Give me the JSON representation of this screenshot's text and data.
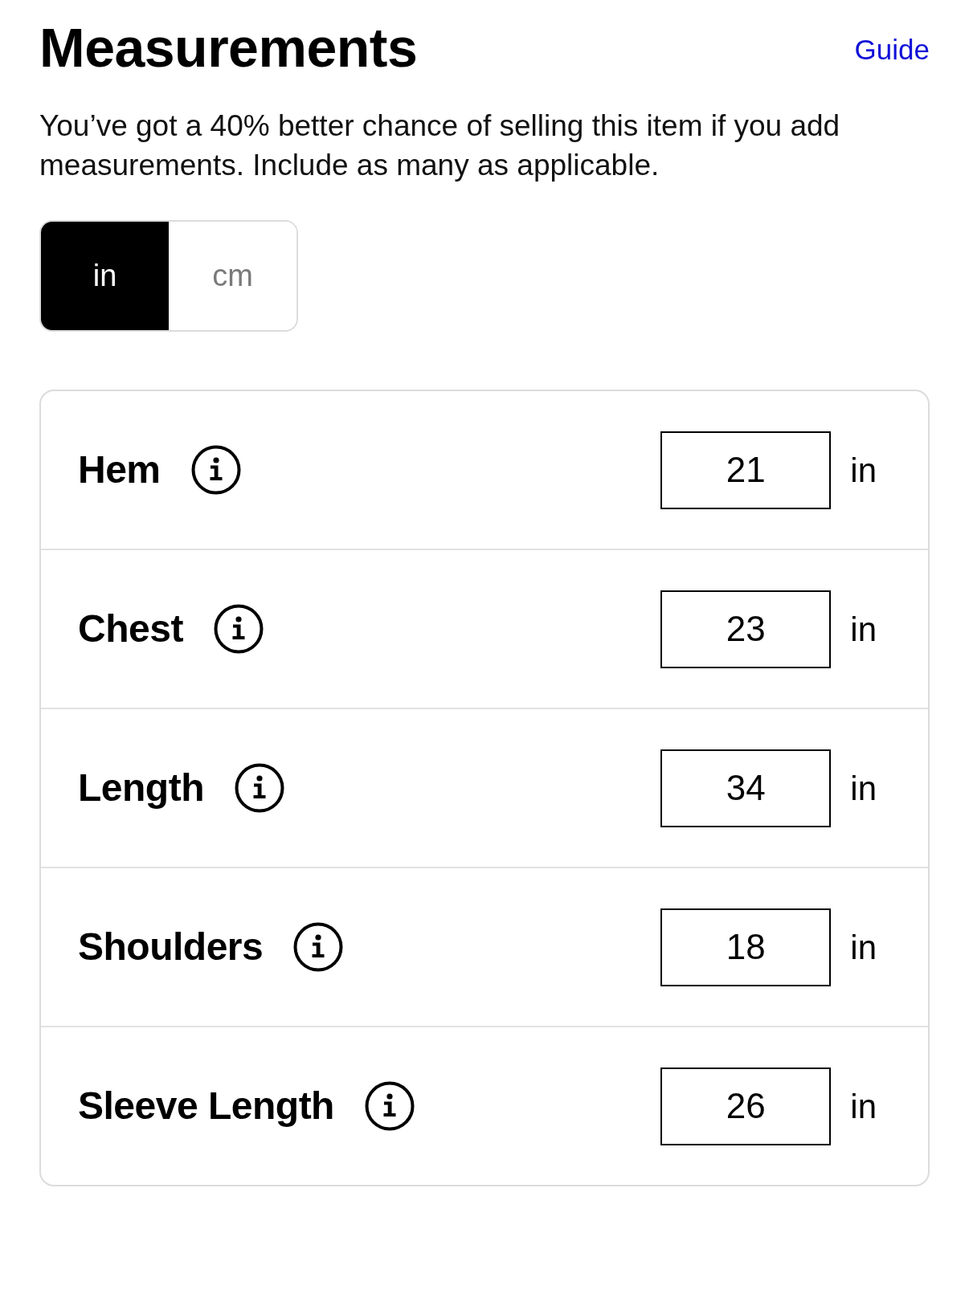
{
  "header": {
    "title": "Measurements",
    "guide_link": "Guide"
  },
  "description": "You’ve got a 40% better chance of selling this item if you add measurements. Include as many as applicable.",
  "unit_toggle": [
    {
      "label": "in",
      "selected": true
    },
    {
      "label": "cm",
      "selected": false
    }
  ],
  "measurements": [
    {
      "label": "Hem",
      "value": "21",
      "unit": "in"
    },
    {
      "label": "Chest",
      "value": "23",
      "unit": "in"
    },
    {
      "label": "Length",
      "value": "34",
      "unit": "in"
    },
    {
      "label": "Shoulders",
      "value": "18",
      "unit": "in"
    },
    {
      "label": "Sleeve Length",
      "value": "26",
      "unit": "in"
    }
  ]
}
